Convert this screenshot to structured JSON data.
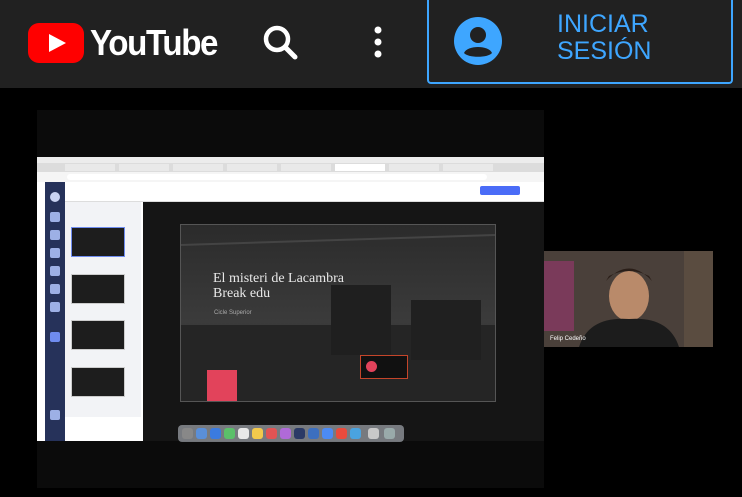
{
  "header": {
    "brand": "YouTube",
    "sign_in_label": "INICIAR SESIÓN",
    "icons": [
      "youtube-play-icon",
      "search-icon",
      "more-vert-icon",
      "account-circle-icon"
    ],
    "accent_color": "#3ea6ff",
    "brand_color": "#ff0000"
  },
  "slide": {
    "title_line1": "El misteri de Lacambra",
    "title_line2": "Break edu",
    "subtitle": "Cicle Superior"
  },
  "webcam": {
    "participant_name": "Felip Cedeño"
  }
}
